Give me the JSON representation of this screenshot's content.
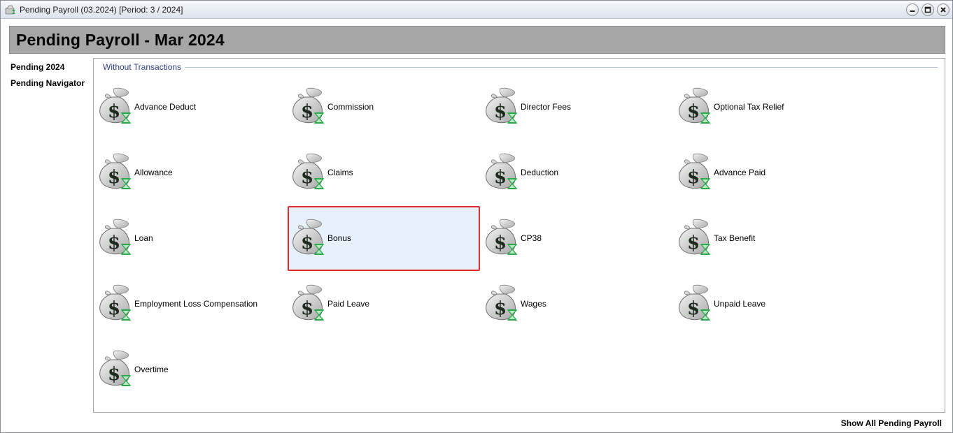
{
  "window": {
    "title": "Pending Payroll (03.2024) [Period: 3 / 2024]"
  },
  "header": {
    "title": "Pending Payroll - Mar 2024"
  },
  "sidebar": {
    "items": [
      {
        "label": "Pending 2024"
      },
      {
        "label": "Pending Navigator"
      }
    ]
  },
  "panel": {
    "group_label": "Without Transactions",
    "selected": "Bonus",
    "tiles": [
      {
        "label": "Advance Deduct",
        "icon": "money-bag-icon"
      },
      {
        "label": "Commission",
        "icon": "money-bag-icon"
      },
      {
        "label": "Director Fees",
        "icon": "money-bag-icon"
      },
      {
        "label": "Optional Tax Relief",
        "icon": "money-bag-icon"
      },
      {
        "label": "Allowance",
        "icon": "money-bag-icon"
      },
      {
        "label": "Claims",
        "icon": "money-bag-icon"
      },
      {
        "label": "Deduction",
        "icon": "money-bag-icon"
      },
      {
        "label": "Advance Paid",
        "icon": "money-bag-icon"
      },
      {
        "label": "Loan",
        "icon": "money-bag-icon"
      },
      {
        "label": "Bonus",
        "icon": "money-bag-icon"
      },
      {
        "label": "CP38",
        "icon": "money-bag-icon"
      },
      {
        "label": "Tax Benefit",
        "icon": "money-bag-icon"
      },
      {
        "label": "Employment Loss Compensation",
        "icon": "money-bag-icon"
      },
      {
        "label": "Paid Leave",
        "icon": "money-bag-icon"
      },
      {
        "label": "Wages",
        "icon": "money-bag-icon"
      },
      {
        "label": "Unpaid Leave",
        "icon": "money-bag-icon"
      },
      {
        "label": "Overtime",
        "icon": "money-bag-icon"
      }
    ]
  },
  "footer": {
    "link": "Show All Pending Payroll"
  },
  "colors": {
    "header_band": "#a6a6a6",
    "selection_border": "#e22b2b",
    "selection_fill": "#e6f1fb",
    "group_label": "#2d3f86",
    "hourglass_green": "#2aa84a"
  }
}
